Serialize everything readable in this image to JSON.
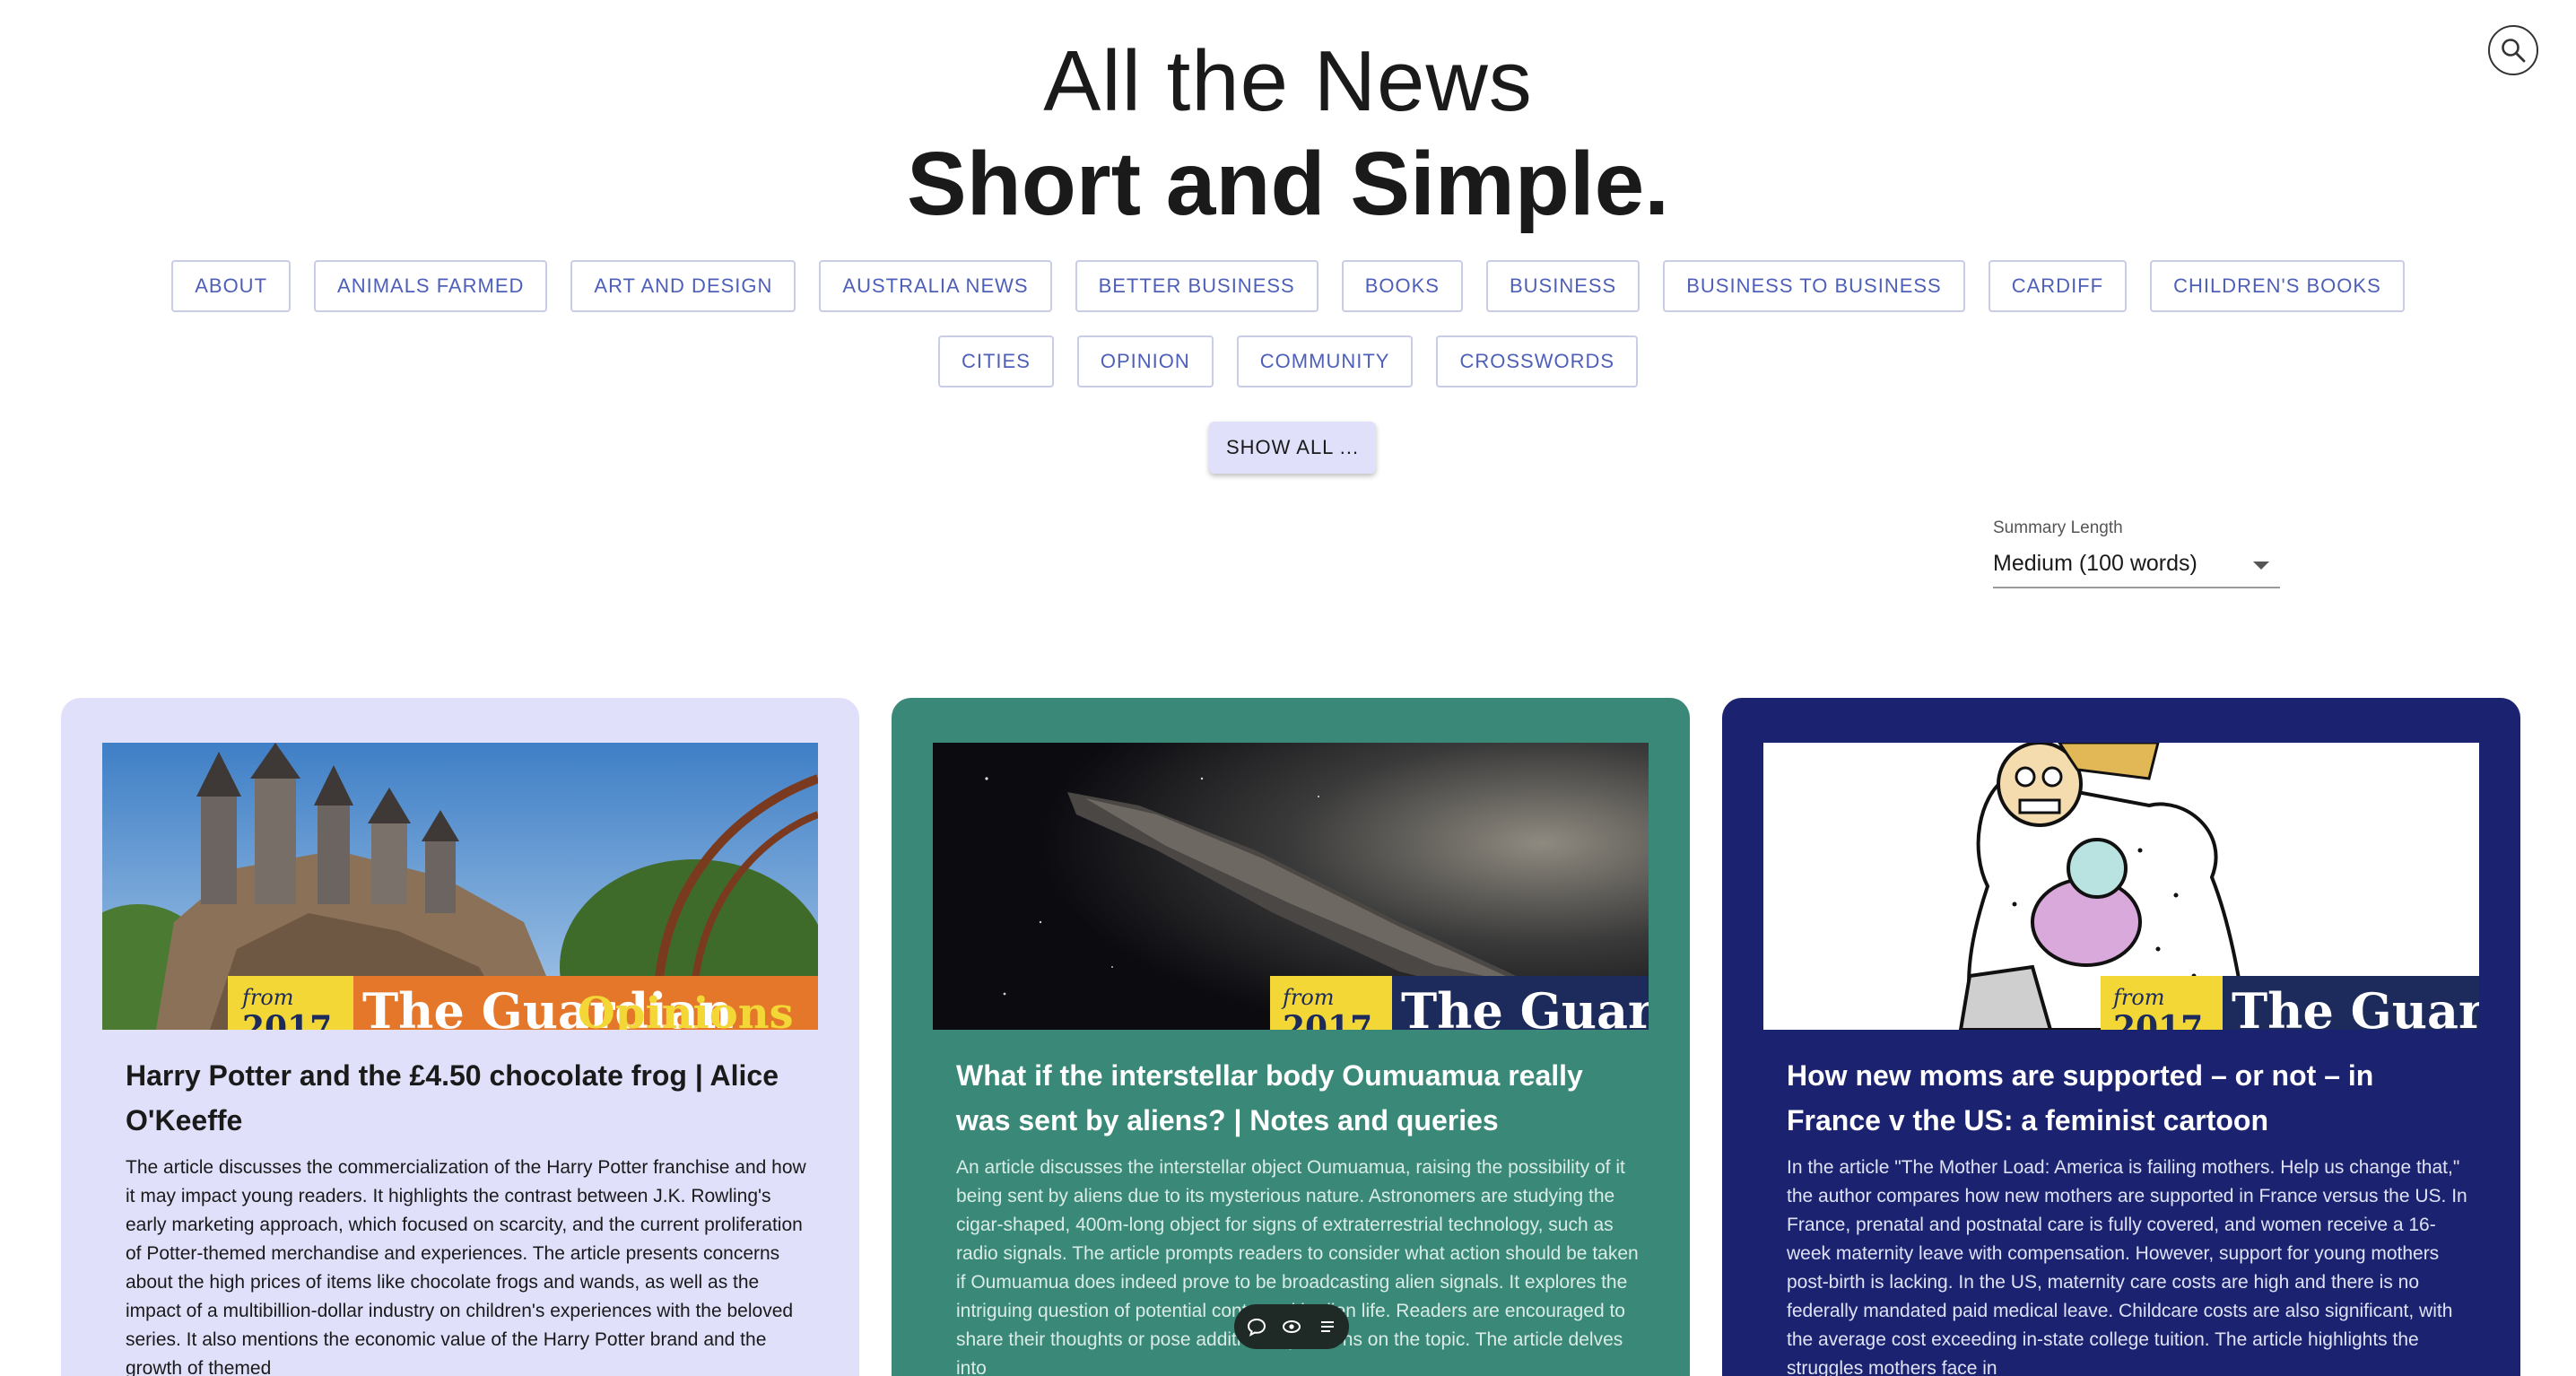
{
  "header": {
    "title_line1": "All the News",
    "title_line2": "Short and Simple."
  },
  "categories": {
    "row1": [
      "ABOUT",
      "ANIMALS FARMED",
      "ART AND DESIGN",
      "AUSTRALIA NEWS",
      "BETTER BUSINESS",
      "BOOKS",
      "BUSINESS",
      "BUSINESS TO BUSINESS",
      "CARDIFF",
      "CHILDREN'S BOOKS"
    ],
    "row2": [
      "CITIES",
      "OPINION",
      "COMMUNITY",
      "CROSSWORDS"
    ],
    "show_all": "SHOW ALL ..."
  },
  "summary_length": {
    "label": "Summary Length",
    "value": "Medium (100 words)"
  },
  "badge": {
    "from": "from",
    "year": "2017",
    "brand": "The Guardian",
    "section": "Opinions"
  },
  "articles": [
    {
      "title": "Harry Potter and the £4.50 chocolate frog | Alice O'Keeffe",
      "summary": "The article discusses the commercialization of the Harry Potter franchise and how it may impact young readers. It highlights the contrast between J.K. Rowling's early marketing approach, which focused on scarcity, and the current proliferation of Potter-themed merchandise and experiences. The article presents concerns about the high prices of items like chocolate frogs and wands, as well as the impact of a multibillion-dollar industry on children's experiences with the beloved series. It also mentions the economic value of the Harry Potter brand and the growth of themed"
    },
    {
      "title": "What if the interstellar body Oumuamua really was sent by aliens? | Notes and queries",
      "summary": "An article discusses the interstellar object Oumuamua, raising the possibility of it being sent by aliens due to its mysterious nature. Astronomers are studying the cigar-shaped, 400m-long object for signs of extraterrestrial technology, such as radio signals. The article prompts readers to consider what action should be taken if Oumuamua does indeed prove to be broadcasting alien signals. It explores the intriguing question of potential contact with alien life. Readers are encouraged to share their thoughts or pose additional questions on the topic. The article delves into"
    },
    {
      "title": "How new moms are supported – or not – in France v the US: a feminist cartoon",
      "summary": "In the article \"The Mother Load: America is failing mothers. Help us change that,\" the author compares how new mothers are supported in France versus the US. In France, prenatal and postnatal care is fully covered, and women receive a 16-week maternity leave with compensation. However, support for young mothers post-birth is lacking. In the US, maternity care costs are high and there is no federally mandated paid medical leave. Childcare costs are also significant, with the average cost exceeding in-state college tuition. The article highlights the struggles mothers face in"
    }
  ],
  "colors": {
    "card1_bg": "#e0e0fb",
    "card2_bg": "#3a8877",
    "card3_bg": "#1b2370",
    "chip_text": "#4e5fb8",
    "badge_yellow": "#f2d736",
    "badge_orange": "#e5772a",
    "badge_navy": "#1d2b5c"
  },
  "icons": {
    "search": "search-icon",
    "toolbar": [
      "chat-icon",
      "eye-icon",
      "list-icon"
    ]
  }
}
